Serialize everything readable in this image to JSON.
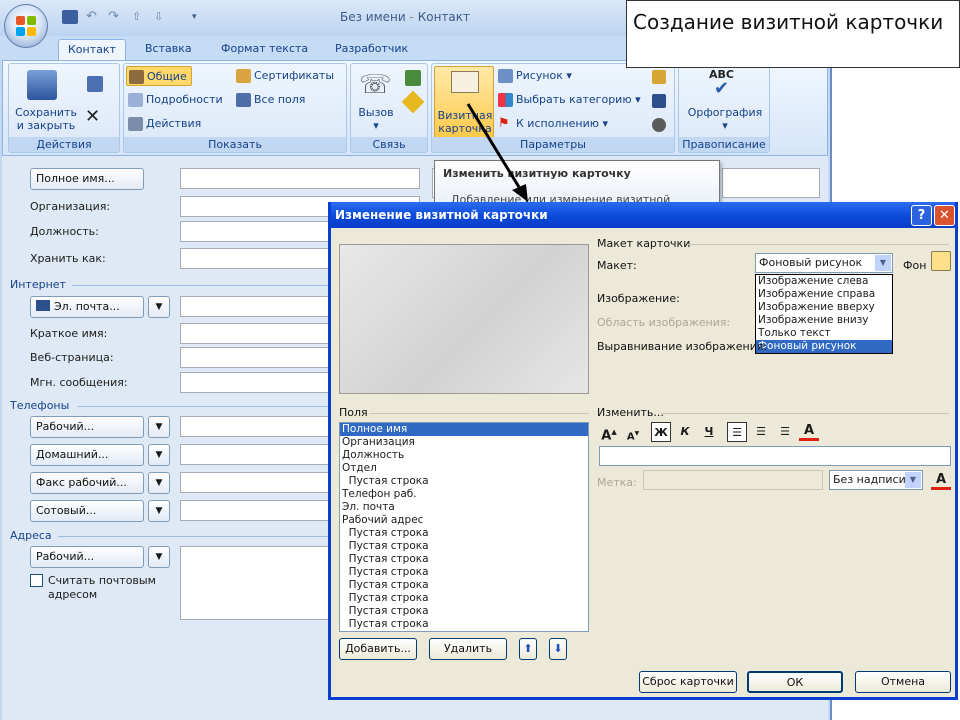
{
  "window": {
    "title": "Без имени",
    "app": "Контакт",
    "title_separator": "-"
  },
  "ribbon": {
    "tabs": [
      "Контакт",
      "Вставка",
      "Формат текста",
      "Разработчик"
    ],
    "actions": {
      "save_close": "Сохранить и закрыть",
      "group": "Действия"
    },
    "show": {
      "general": "Общие",
      "details": "Подробности",
      "activities": "Действия",
      "certificates": "Сертификаты",
      "all_fields": "Все поля",
      "group": "Показать"
    },
    "communicate": {
      "call": "Вызов",
      "group": "Связь"
    },
    "options": {
      "business_card": "Визитная карточка",
      "picture": "Рисунок",
      "categorize": "Выбрать категорию",
      "follow_up": "К исполнению",
      "group": "Параметры"
    },
    "proofing": {
      "spelling": "Орфография",
      "abc": "ABC",
      "group": "Правописание"
    }
  },
  "tooltip": {
    "title": "Изменить визитную карточку",
    "body": "Добавление или изменение визитной"
  },
  "slide_title": "Создание визитной карточки",
  "form": {
    "full_name": "Полное имя...",
    "company": "Организация:",
    "job_title": "Должность:",
    "file_as": "Хранить как:",
    "internet": "Интернет",
    "email": "Эл. почта...",
    "display_as": "Краткое имя:",
    "web_page": "Веб-страница:",
    "im_address": "Мгн. сообщения:",
    "phones": "Телефоны",
    "phone_business": "Рабочий...",
    "phone_home": "Домашний...",
    "phone_fax": "Факс рабочий...",
    "phone_mobile": "Сотовый...",
    "addresses": "Адреса",
    "address_business": "Рабочий...",
    "mailing_line1": "Считать почтовым",
    "mailing_line2": "адресом"
  },
  "dialog": {
    "title": "Изменение визитной карточки",
    "help_btn": "?",
    "close_btn": "✕",
    "card_design": "Макет карточки",
    "layout_label": "Макет:",
    "layout_value": "Фоновый рисунок",
    "background_label": "Фон",
    "layout_options": [
      "Изображение слева",
      "Изображение справа",
      "Изображение вверху",
      "Изображение внизу",
      "Только текст",
      "Фоновый рисунок"
    ],
    "layout_selected_index": 5,
    "image_label": "Изображение:",
    "image_area_label": "Область изображения:",
    "image_align_label": "Выравнивание изображения:",
    "fields_label": "Поля",
    "fields": [
      "Полное имя",
      "Организация",
      "Должность",
      "Отдел",
      "  Пустая строка",
      "Телефон раб.",
      "Эл. почта",
      "Рабочий адрес",
      "  Пустая строка",
      "  Пустая строка",
      "  Пустая строка",
      "  Пустая строка",
      "  Пустая строка",
      "  Пустая строка",
      "  Пустая строка",
      "  Пустая строка"
    ],
    "fields_selected_index": 0,
    "edit_label": "Изменить...",
    "fmt": {
      "grow": "A",
      "shrink": "A",
      "bold": "Ж",
      "italic": "К",
      "underline": "Ч",
      "color": "A"
    },
    "label_label": "Метка:",
    "label_value": "Без надписи",
    "add_btn": "Добавить...",
    "remove_btn": "Удалить",
    "reset_btn": "Сброс карточки",
    "ok_btn": "ОК",
    "cancel_btn": "Отмена"
  }
}
